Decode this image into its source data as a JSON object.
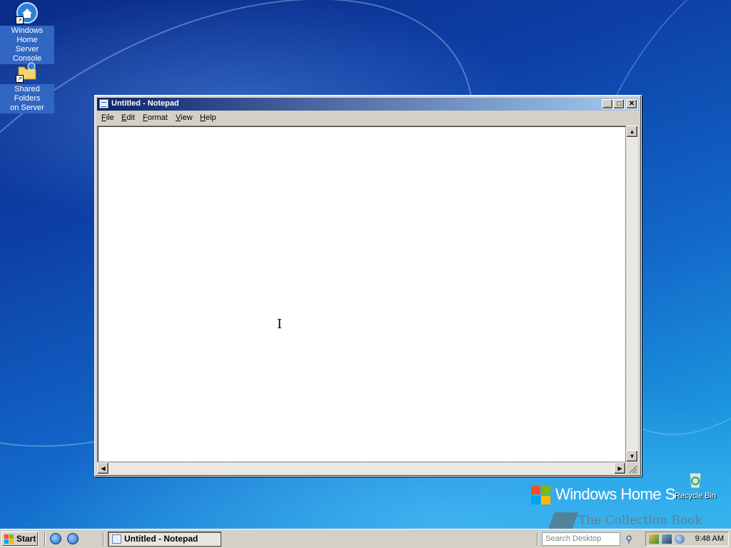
{
  "desktop": {
    "icons": [
      {
        "label_line1": "Windows Home",
        "label_line2": "Server Console"
      },
      {
        "label_line1": "Shared Folders",
        "label_line2": "on Server"
      },
      {
        "label": "Recycle Bin"
      }
    ],
    "branding": "Windows Home S",
    "watermark": "The Collection Book"
  },
  "window": {
    "title": "Untitled - Notepad",
    "menu": [
      {
        "accel": "F",
        "rest": "ile"
      },
      {
        "accel": "E",
        "rest": "dit"
      },
      {
        "accel": "F",
        "rest": "ormat",
        "prefix": "F"
      },
      {
        "accel": "V",
        "rest": "iew"
      },
      {
        "accel": "H",
        "rest": "elp"
      }
    ],
    "controls": {
      "minimize": "_",
      "maximize": "□",
      "close": "✕"
    },
    "cursor_glyph": "I"
  },
  "taskbar": {
    "start_label": "Start",
    "task_label": "Untitled - Notepad",
    "search_placeholder": "Search Desktop",
    "search_icon": "⚲",
    "clock": "9:48 AM"
  },
  "colors": {
    "title_active_start": "#0a246a",
    "title_active_end": "#a6caf0",
    "desktop_top": "#0b2b86",
    "desktop_bottom": "#35b4ee"
  }
}
